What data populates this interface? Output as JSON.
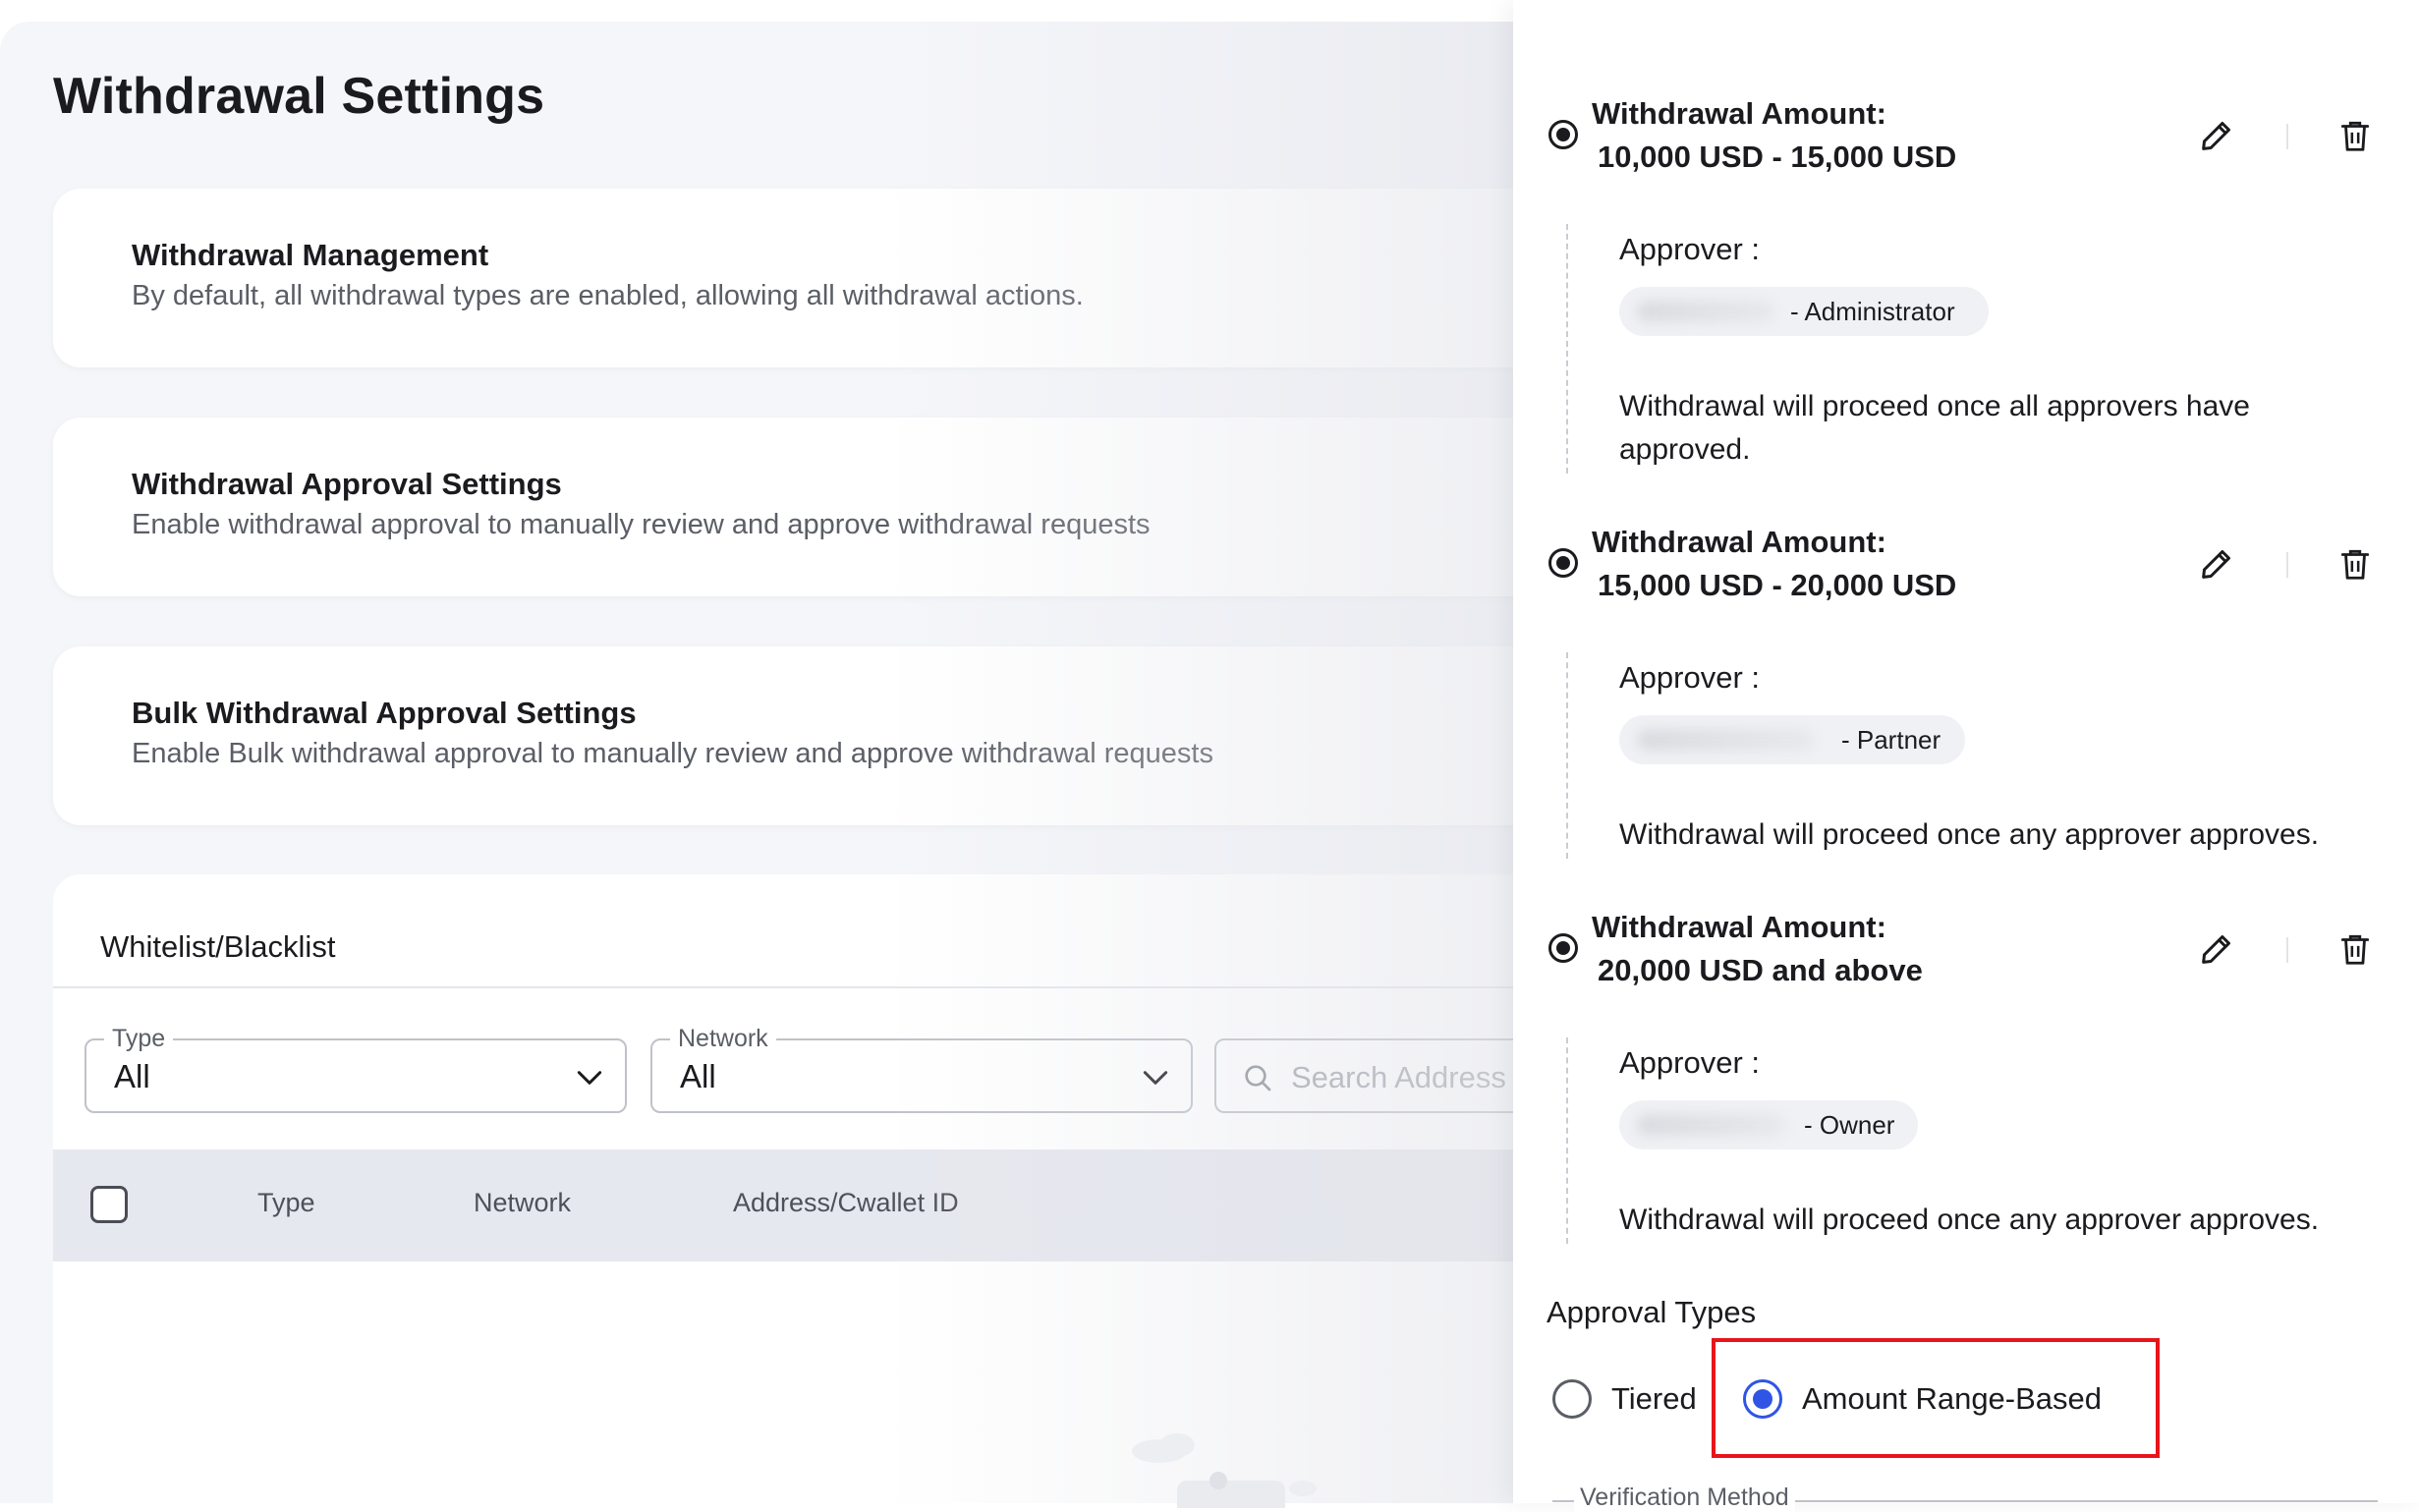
{
  "page": {
    "title": "Withdrawal Settings"
  },
  "cards": [
    {
      "title": "Withdrawal Management",
      "description": "By default, all withdrawal types are enabled, allowing all withdrawal actions."
    },
    {
      "title": "Withdrawal Approval Settings",
      "description": "Enable withdrawal approval to manually review and approve withdrawal requests"
    },
    {
      "title": "Bulk Withdrawal Approval Settings",
      "description": "Enable Bulk withdrawal approval to manually review and approve withdrawal requests"
    }
  ],
  "whitelist": {
    "title": "Whitelist/Blacklist",
    "filters": {
      "type": {
        "label": "Type",
        "value": "All"
      },
      "network": {
        "label": "Network",
        "value": "All"
      },
      "search_placeholder": "Search Address"
    },
    "columns": [
      "Type",
      "Network",
      "Address/Cwallet ID"
    ]
  },
  "drawer": {
    "ranges": [
      {
        "label": "Withdrawal Amount:",
        "value": "10,000 USD - 15,000 USD",
        "approver_label": "Approver :",
        "approver_role": "- Administrator",
        "rule": "Withdrawal will proceed once all approvers have approved."
      },
      {
        "label": "Withdrawal Amount:",
        "value": "15,000 USD - 20,000 USD",
        "approver_label": "Approver :",
        "approver_role": "- Partner",
        "rule": "Withdrawal will proceed once any approver approves."
      },
      {
        "label": "Withdrawal Amount:",
        "value": "20,000 USD and above",
        "approver_label": "Approver :",
        "approver_role": "- Owner",
        "rule": "Withdrawal will proceed once any approver approves."
      }
    ],
    "approval_types": {
      "title": "Approval Types",
      "options": [
        {
          "label": "Tiered",
          "selected": false
        },
        {
          "label": "Amount Range-Based",
          "selected": true
        }
      ]
    },
    "verification_label": "Verification Method"
  },
  "colors": {
    "accent": "#2f55e4",
    "highlight": "#e8141c"
  }
}
